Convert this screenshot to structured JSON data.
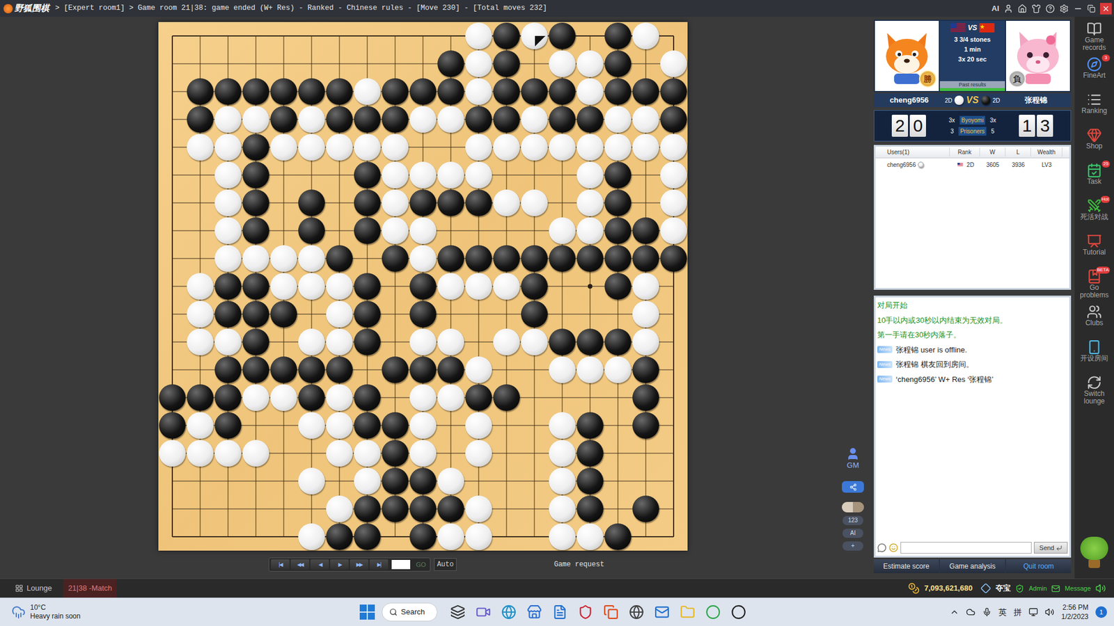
{
  "window": {
    "logo": "野狐围棋",
    "title": "> [Expert room1] > Game room 21|38: game ended (W+ Res) - Ranked - Chinese rules - [Move 230] - [Total moves 232]",
    "ai": "AI"
  },
  "board": {
    "rows": [
      "...........WBWB.BW.",
      "..........BWB.WWB.W",
      ".BBBBBBWBBBWBBBWBBB",
      ".BWWBWBBBWWBBWBBWWB",
      ".WWBWWWWW..WWWWWWWW",
      "..WB...BWWWW...WB.W",
      "..WB.B.BWBBBWW.WB.W",
      "..WB.B.BWW....WWBBW",
      "..WWWWB.BWBBBBBBBBB",
      ".WBBWWWB.BWWWB..BW.",
      ".WBBB.WB.B...B...W.",
      ".WWB.WWB.WW.WWBBBW.",
      "..BBBBB.BBBW..WWWB.",
      "BBBWWBWB.WWBB....B.",
      "BWB..WWBBW.W..WB.B.",
      "WWWW..WWBW.W..WB...",
      ".....W.WBBW...WB...",
      "......WBBBBW..WB.B.",
      ".....WBB.BWW..WWB.."
    ],
    "last_move": {
      "row": 0,
      "col": 13
    }
  },
  "playback": {
    "buttons": [
      "|◀",
      "◀◀",
      "◀",
      "▶",
      "▶▶",
      "▶|"
    ],
    "go": {
      "label": "GO",
      "disabled": true
    },
    "auto": "Auto",
    "game_request": "Game request"
  },
  "side_tools": [
    {
      "kind": "gm",
      "label": "GM"
    },
    {
      "kind": "share",
      "label": ""
    },
    {
      "kind": "stones",
      "label": ""
    },
    {
      "kind": "text",
      "label": "123"
    },
    {
      "kind": "text",
      "label": "AI"
    },
    {
      "kind": "text",
      "label": "+"
    }
  ],
  "players": {
    "white": {
      "name": "cheng6956",
      "rank": "2D",
      "flag": "US",
      "badge": "勝"
    },
    "black": {
      "name": "张程锦",
      "rank": "2D",
      "flag": "CN",
      "badge": "負"
    },
    "vs": "VS",
    "komi": "3 3/4 stones",
    "time": "1 min",
    "byoyomi": "3x 20 sec",
    "past_results": "Past results"
  },
  "clock": {
    "white_digits": [
      "2",
      "0"
    ],
    "black_digits": [
      "1",
      "3"
    ],
    "white_periods": "3x",
    "byoyomi_label": "Byoyomi",
    "black_periods": "3x",
    "white_prisoners": "3",
    "prisoners_label": "Prisoners",
    "black_prisoners": "5"
  },
  "users": {
    "columns": [
      "Users(1)",
      "Rank",
      "W",
      "L",
      "Wealth"
    ],
    "rows": [
      {
        "name": "cheng6956",
        "flag": "US",
        "rank": "2D",
        "w": "3605",
        "l": "3936",
        "wealth": "LV3"
      }
    ]
  },
  "chat": {
    "messages": [
      {
        "kind": "system",
        "badge": "",
        "text": "对局开始"
      },
      {
        "kind": "system",
        "badge": "",
        "text": "10手以内或30秒以内结束为无效对局。"
      },
      {
        "kind": "system",
        "badge": "",
        "text": "第一手请在30秒内落子。"
      },
      {
        "kind": "news",
        "badge": "News",
        "text": "张程锦 user is offline."
      },
      {
        "kind": "news",
        "badge": "News",
        "text": "张程锦 棋友回到房间。"
      },
      {
        "kind": "news",
        "badge": "News",
        "text": "‘cheng6956’ W+ Res ‘张程锦’"
      }
    ],
    "input": "",
    "send": "Send"
  },
  "actions": [
    {
      "label": "Estimate score",
      "primary": false
    },
    {
      "label": "Game analysis",
      "primary": false
    },
    {
      "label": "Quit room",
      "primary": true
    }
  ],
  "sidebar": [
    {
      "label": "Game records",
      "badge": ""
    },
    {
      "label": "FineArt",
      "badge": "3"
    },
    {
      "label": "Ranking",
      "badge": ""
    },
    {
      "label": "Shop",
      "badge": ""
    },
    {
      "label": "Task",
      "badge": "25"
    },
    {
      "label": "死活对战",
      "badge": "Hot"
    },
    {
      "label": "Tutorial",
      "badge": ""
    },
    {
      "label": "Go problems",
      "badge": "BETA"
    },
    {
      "label": "Clubs",
      "badge": ""
    },
    {
      "label": "开设房间",
      "badge": ""
    },
    {
      "label": "Switch lounge",
      "badge": ""
    }
  ],
  "status_bar": {
    "tabs": [
      {
        "label": "Lounge",
        "selected": false
      },
      {
        "label": "21|38 -Match",
        "selected": true
      }
    ],
    "coins": "7,093,621,680",
    "treasure": "夺宝",
    "admin": "Admin",
    "message": "Message"
  },
  "taskbar": {
    "temp": "10°C",
    "weather": "Heavy rain soon",
    "search": "Search",
    "ime": [
      "英",
      "拼"
    ],
    "time": "2:56 PM",
    "date": "1/2/2023",
    "notifications": "1"
  }
}
